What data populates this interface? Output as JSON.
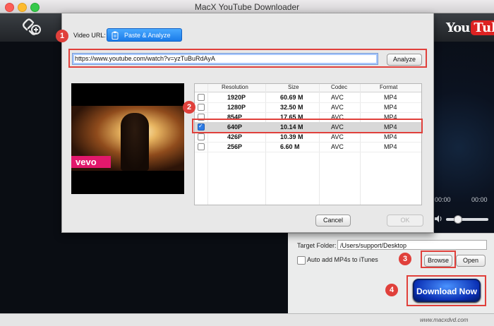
{
  "window": {
    "title": "MacX YouTube Downloader"
  },
  "toolbar": {
    "youtube_logo": {
      "you": "You",
      "tube": "Tube"
    }
  },
  "dialog": {
    "video_url_label": "Video URL:",
    "paste_analyze_label": "Paste & Analyze",
    "url_value": "https://www.youtube.com/watch?v=yzTuBuRdAyA",
    "analyze_label": "Analyze",
    "preview_badge": "vevo",
    "table": {
      "headers": [
        "Resolution",
        "Size",
        "Codec",
        "Format"
      ],
      "rows": [
        {
          "checked": false,
          "resolution": "1920P",
          "size": "60.69 M",
          "codec": "AVC",
          "format": "MP4"
        },
        {
          "checked": false,
          "resolution": "1280P",
          "size": "32.50 M",
          "codec": "AVC",
          "format": "MP4"
        },
        {
          "checked": false,
          "resolution": "854P",
          "size": "17.65 M",
          "codec": "AVC",
          "format": "MP4"
        },
        {
          "checked": true,
          "resolution": "640P",
          "size": "10.14 M",
          "codec": "AVC",
          "format": "MP4"
        },
        {
          "checked": false,
          "resolution": "426P",
          "size": "10.39 M",
          "codec": "AVC",
          "format": "MP4"
        },
        {
          "checked": false,
          "resolution": "256P",
          "size": "6.60 M",
          "codec": "AVC",
          "format": "MP4"
        }
      ]
    },
    "cancel_label": "Cancel",
    "ok_label": "OK"
  },
  "player": {
    "time_left": "00:00",
    "time_right": "00:00"
  },
  "output": {
    "target_folder_label": "Target Folder:",
    "target_folder_value": "/Users/support/Desktop",
    "itunes_label": "Auto add MP4s to iTunes",
    "itunes_checked": false,
    "browse_label": "Browse",
    "open_label": "Open",
    "download_label": "Download Now"
  },
  "footer": {
    "brand_url": "www.macxdvd.com"
  },
  "annotations": {
    "badges": [
      "1",
      "2",
      "3",
      "4"
    ],
    "color": "#e0403b"
  },
  "colors": {
    "accent_blue": "#1a7be9",
    "download_blue": "#0a2fb4",
    "highlight_red": "#e0403b"
  },
  "icons": {
    "add_link": "link-plus-icon",
    "paste": "clipboard-icon",
    "speaker": "speaker-icon"
  }
}
